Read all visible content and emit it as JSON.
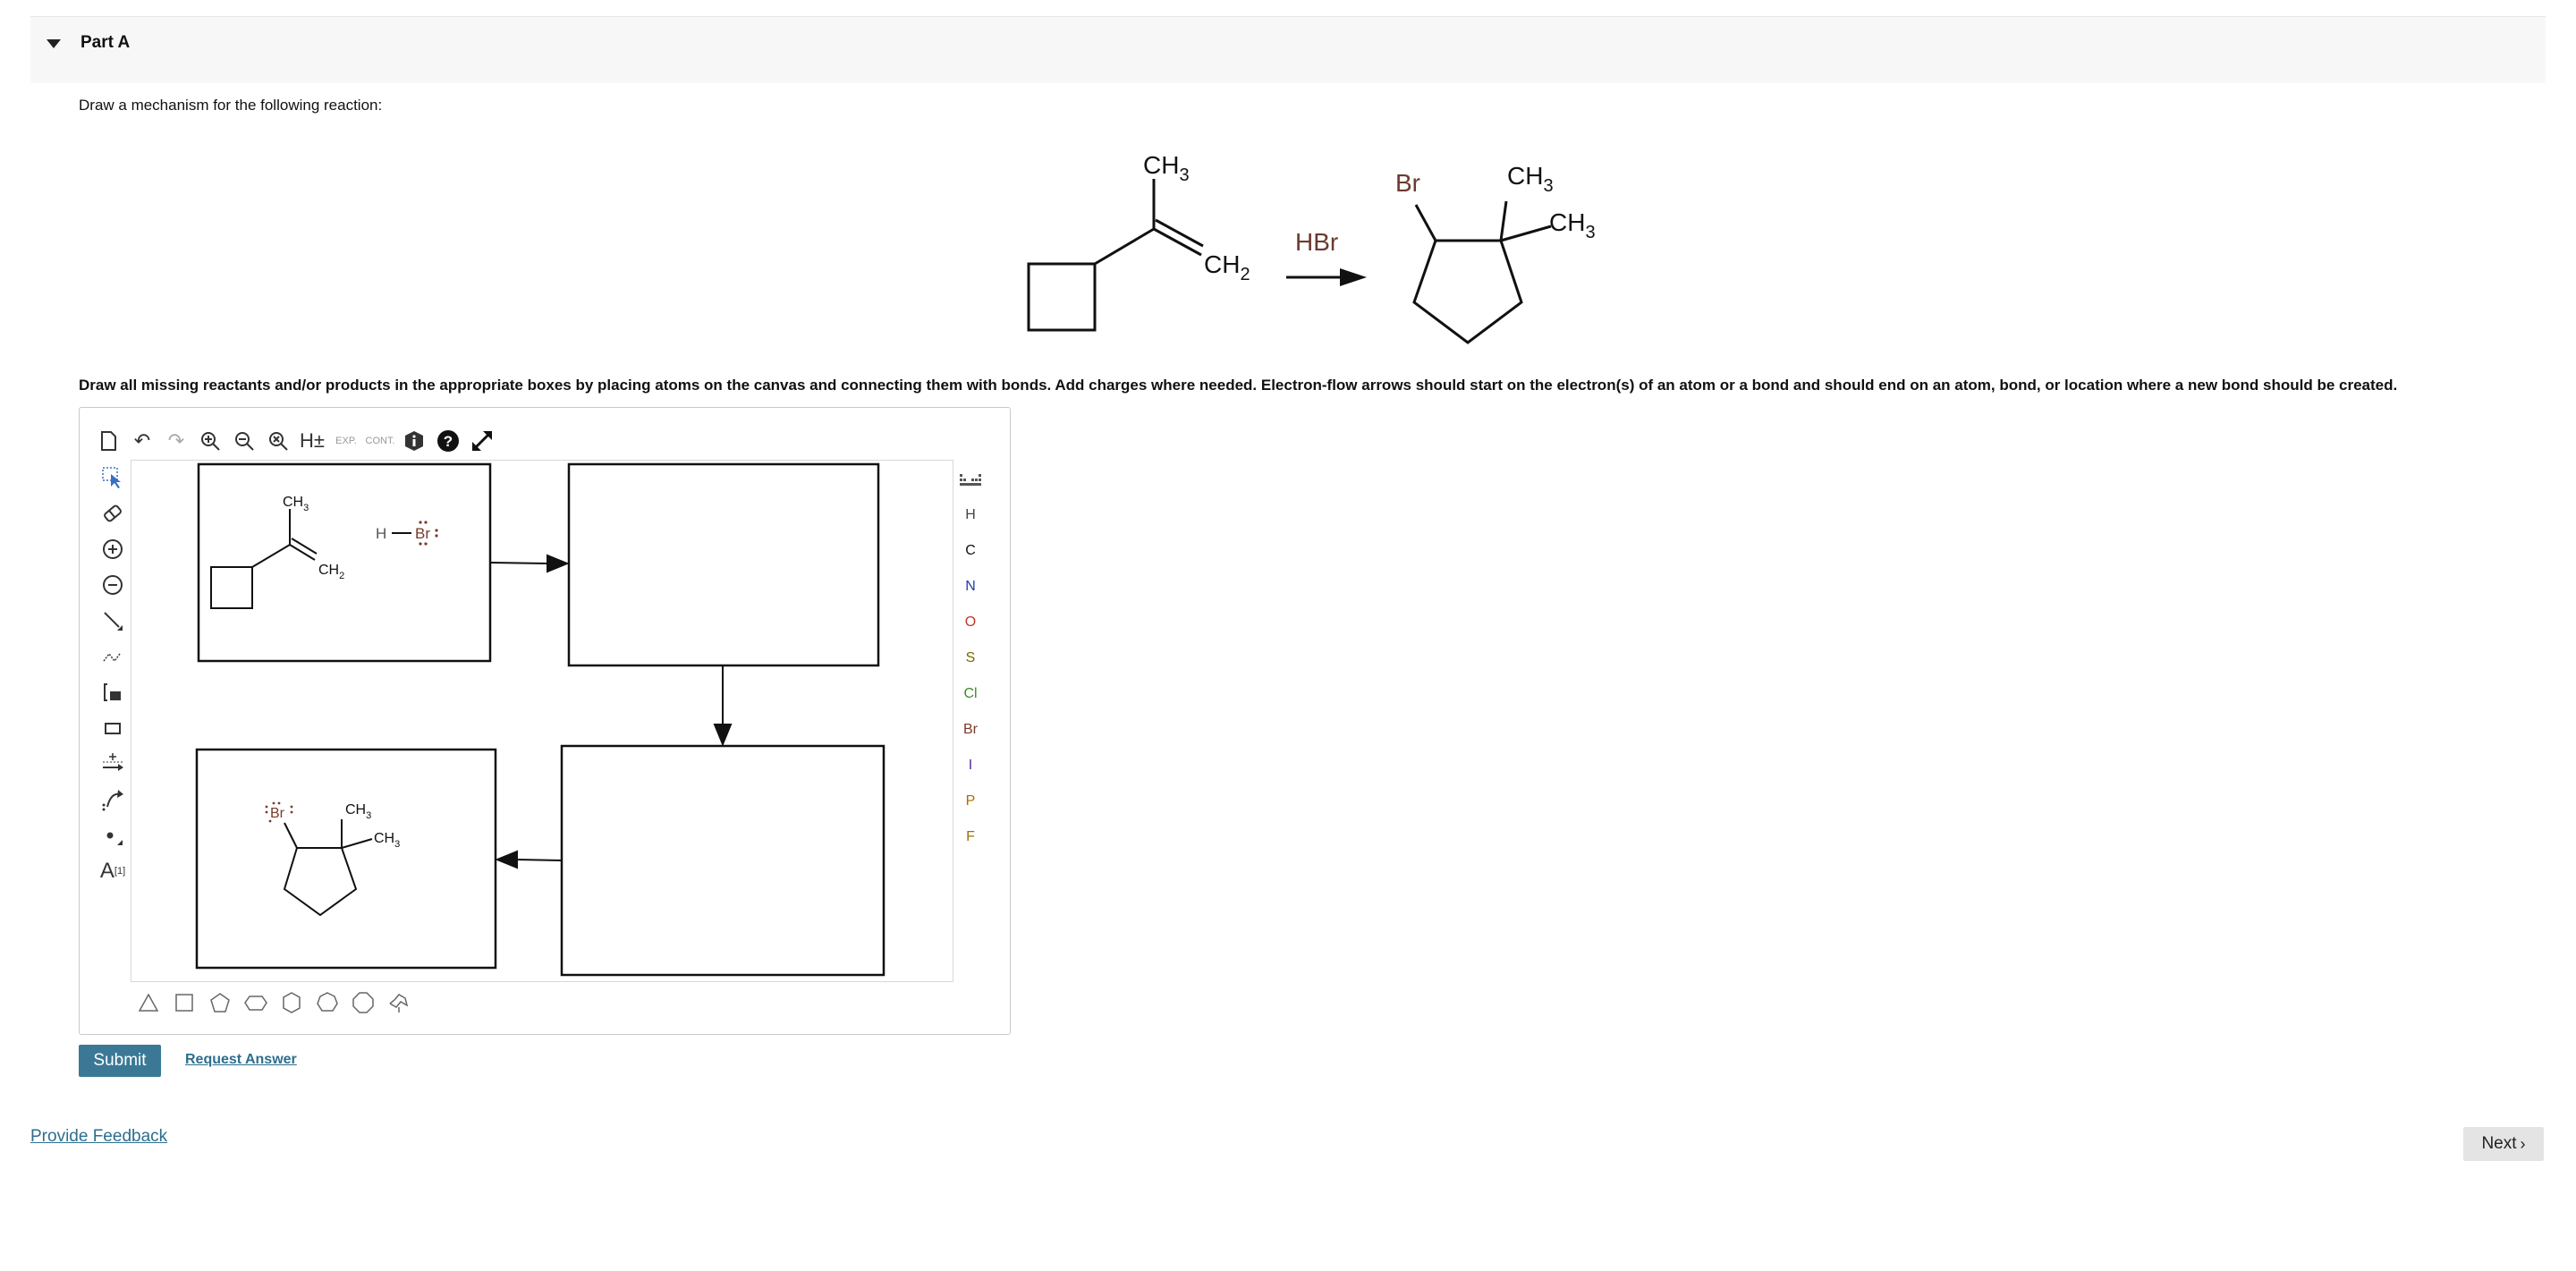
{
  "part": {
    "title": "Part A"
  },
  "prompt": "Draw a mechanism for the following reaction:",
  "instructions": "Draw all missing reactants and/or products in the appropriate boxes by placing atoms on the canvas and connecting them with bonds. Add charges where needed. Electron-flow arrows should start on the electron(s) of an atom or a bond and should end on an atom, bond, or location where a new bond should be created.",
  "reaction": {
    "reagent": "HBr",
    "reactant_labels": {
      "ch3": "CH",
      "ch3_sub": "3",
      "ch2": "CH",
      "ch2_sub": "2"
    },
    "product_labels": {
      "br": "Br",
      "ch3_a": "CH",
      "ch3_a_sub": "3",
      "ch3_b": "CH",
      "ch3_b_sub": "3"
    }
  },
  "editor": {
    "toolbar_top": [
      "new-document",
      "undo",
      "redo",
      "zoom-in",
      "zoom-out",
      "zoom-fit",
      "hydrogen-toggle",
      "expand",
      "contract",
      "info",
      "help",
      "fullscreen"
    ],
    "toolbar_top_text": {
      "h_label": "H±",
      "exp_label": "EXP.",
      "cont_label": "CONT."
    },
    "toolbar_left": [
      "select",
      "eraser",
      "positive-charge",
      "negative-charge",
      "bond",
      "chain",
      "bracket",
      "rectangle",
      "electron-arrow",
      "curved-arrow",
      "lone-pair",
      "text"
    ],
    "text_tool": {
      "label": "A",
      "sup": "[1]"
    },
    "periodic_table_icon": "periodic-table-icon",
    "atoms": [
      {
        "symbol": "H",
        "color": "#444444"
      },
      {
        "symbol": "C",
        "color": "#111111"
      },
      {
        "symbol": "N",
        "color": "#1f3fa8"
      },
      {
        "symbol": "O",
        "color": "#c0392b"
      },
      {
        "symbol": "S",
        "color": "#7a6a00"
      },
      {
        "symbol": "Cl",
        "color": "#3a8a2a"
      },
      {
        "symbol": "Br",
        "color": "#7a3a2a"
      },
      {
        "symbol": "I",
        "color": "#5a2a9a"
      },
      {
        "symbol": "P",
        "color": "#b06a00"
      },
      {
        "symbol": "F",
        "color": "#a07000"
      }
    ],
    "templates": [
      "triangle-icon",
      "square-icon",
      "pentagon-icon",
      "hexagon-icon",
      "heptagon-icon",
      "octagon-icon",
      "chair-icon"
    ],
    "canvas_labels": {
      "hbr_h": "H",
      "hbr_br": "Br",
      "box1_ch3": "CH",
      "box1_ch3_sub": "3",
      "box1_ch2": "CH",
      "box1_ch2_sub": "2",
      "box4_br": "Br",
      "box4_ch3_a": "CH",
      "box4_ch3_a_sub": "3",
      "box4_ch3_b": "CH",
      "box4_ch3_b_sub": "3"
    }
  },
  "buttons": {
    "submit": "Submit",
    "request_answer": "Request Answer",
    "feedback": "Provide Feedback",
    "next": "Next"
  },
  "colors": {
    "accent": "#3a7896",
    "link": "#2d6e8f",
    "bromine": "#7a3a2a"
  }
}
